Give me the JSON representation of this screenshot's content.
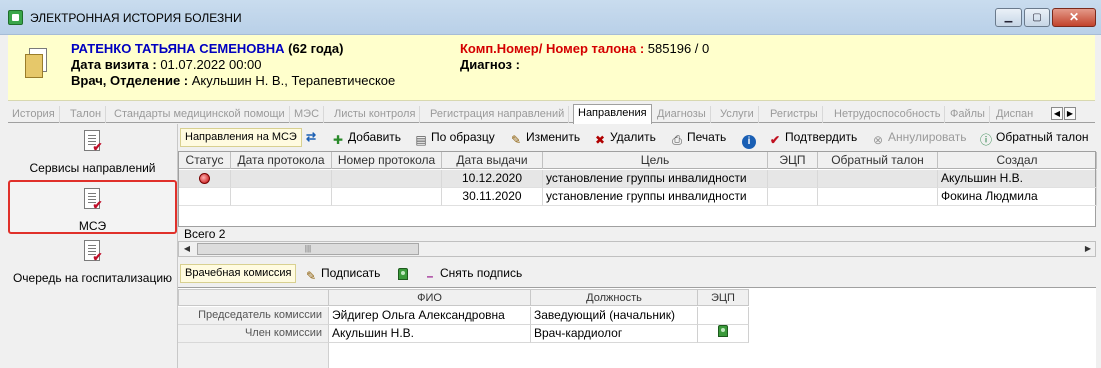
{
  "window": {
    "title": "ЭЛЕКТРОННАЯ ИСТОРИЯ БОЛЕЗНИ",
    "min_label": "▁",
    "max_label": "▢",
    "close_label": "✕"
  },
  "patient": {
    "name": "РАТЕНКО ТАТЬЯНА СЕМЕНОВНА",
    "age": "(62 года)",
    "visit_label": "Дата визита :",
    "visit_value": "01.07.2022 00:00",
    "doctor_label": "Врач, Отделение :",
    "doctor_value": "Акульшин Н. В., Терапевтическое",
    "comp_label": "Комп.Номер/ Номер талона :",
    "comp_value": "585196 / 0",
    "diag_label": "Диагноз :"
  },
  "tabs": [
    {
      "label": "История"
    },
    {
      "label": "Талон"
    },
    {
      "label": "Стандарты медицинской помощи"
    },
    {
      "label": "МЭС"
    },
    {
      "label": "Листы контроля"
    },
    {
      "label": "Регистрация направлений"
    },
    {
      "label": "Направления"
    },
    {
      "label": "Диагнозы"
    },
    {
      "label": "Услуги"
    },
    {
      "label": "Регистры"
    },
    {
      "label": "Нетрудоспособность"
    },
    {
      "label": "Файлы"
    },
    {
      "label": "Диспан"
    }
  ],
  "sidebar": {
    "items": [
      {
        "label": "Сервисы направлений"
      },
      {
        "label": "МСЭ"
      },
      {
        "label": "Очередь на госпитализацию"
      }
    ]
  },
  "toolbar": {
    "title": "Направления на МСЭ",
    "refresh_icon": "⇄",
    "add": "Добавить",
    "by_template": "По образцу",
    "edit": "Изменить",
    "delete": "Удалить",
    "print": "Печать",
    "info_icon": "i",
    "confirm": "Подтвердить",
    "cancel": "Аннулировать",
    "feedback": "Обратный талон"
  },
  "grid": {
    "columns": [
      "Статус",
      "Дата протокола",
      "Номер протокола",
      "Дата выдачи",
      "Цель",
      "ЭЦП",
      "Обратный талон",
      "Создал"
    ],
    "rows": [
      {
        "date_issued": "10.12.2020",
        "goal": "установление группы инвалидности",
        "created_by": "Акульшин Н.В."
      },
      {
        "date_issued": "30.11.2020",
        "goal": "установление группы инвалидности",
        "created_by": "Фокина Людмила"
      }
    ],
    "total": "Всего 2"
  },
  "commission": {
    "title": "Врачебная комиссия",
    "sign": "Подписать",
    "unsign": "Снять подпись",
    "columns": [
      "ФИО",
      "Должность",
      "ЭЦП"
    ],
    "rows": [
      {
        "role": "Председатель комиссии",
        "name": "Эйдигер Ольга Александровна",
        "position": "Заведующий (начальник)",
        "signed": false
      },
      {
        "role": "Член комиссии",
        "name": "Акульшин Н.В.",
        "position": "Врач-кардиолог",
        "signed": true
      }
    ]
  }
}
